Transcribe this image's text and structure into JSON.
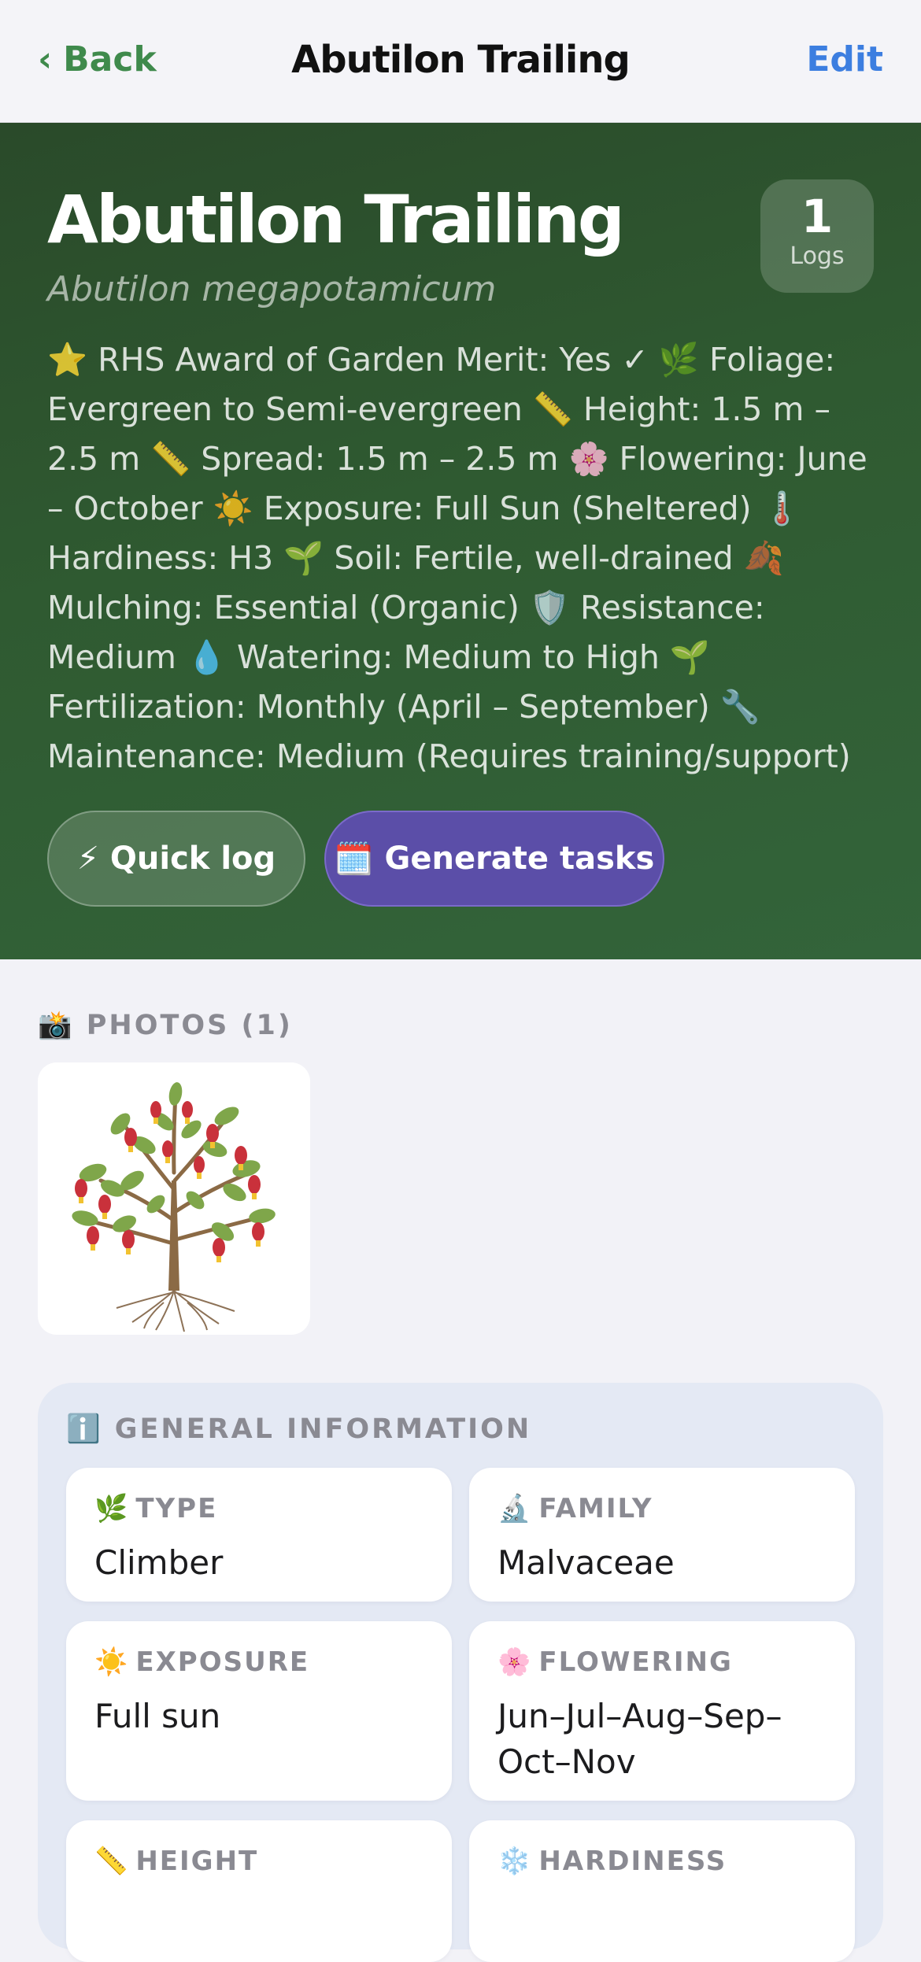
{
  "nav": {
    "back_chevron": "‹",
    "back_label": "Back",
    "title": "Abutilon Trailing",
    "edit_label": "Edit"
  },
  "hero": {
    "title": "Abutilon Trailing",
    "scientific_name": "Abutilon megapotamicum",
    "logs_count": "1",
    "logs_label": "Logs",
    "description": "⭐ RHS Award of Garden Merit: Yes ✓ 🌿 Foliage: Evergreen to Semi-evergreen 📏 Height: 1.5 m – 2.5 m 📏 Spread: 1.5 m – 2.5 m 🌸 Flowering: June – October ☀️ Exposure: Full Sun (Sheltered) 🌡️ Hardiness: H3 🌱 Soil: Fertile, well-drained 🍂 Mulching: Essential (Organic) 🛡️ Resistance: Medium 💧 Watering: Medium to High 🌱 Fertilization: Monthly (April – September) 🔧 Maintenance: Medium (Requires training/support)",
    "quick_log_icon": "⚡",
    "quick_log_label": "Quick log",
    "generate_tasks_icon": "🗓️",
    "generate_tasks_label": "Generate tasks"
  },
  "photos": {
    "header_icon": "📸",
    "header_label": "PHOTOS (1)",
    "items": [
      {
        "icon": "plant-illustration"
      }
    ]
  },
  "general_info": {
    "header_icon": "ℹ️",
    "header_label": "GENERAL INFORMATION",
    "cards": [
      {
        "icon": "🌿",
        "label": "TYPE",
        "value": "Climber"
      },
      {
        "icon": "🔬",
        "label": "FAMILY",
        "value": "Malvaceae"
      },
      {
        "icon": "☀️",
        "label": "EXPOSURE",
        "value": "Full sun"
      },
      {
        "icon": "🌸",
        "label": "FLOWERING",
        "value": "Jun–Jul–Aug–Sep–Oct–Nov"
      },
      {
        "icon": "📏",
        "label": "HEIGHT",
        "value": ""
      },
      {
        "icon": "❄️",
        "label": "HARDINESS",
        "value": ""
      }
    ]
  },
  "colors": {
    "accent_green": "#3f8a4c",
    "accent_blue": "#3c7ee0",
    "hero_green": "#2f5a31",
    "purple_button": "#5b4ea8"
  }
}
